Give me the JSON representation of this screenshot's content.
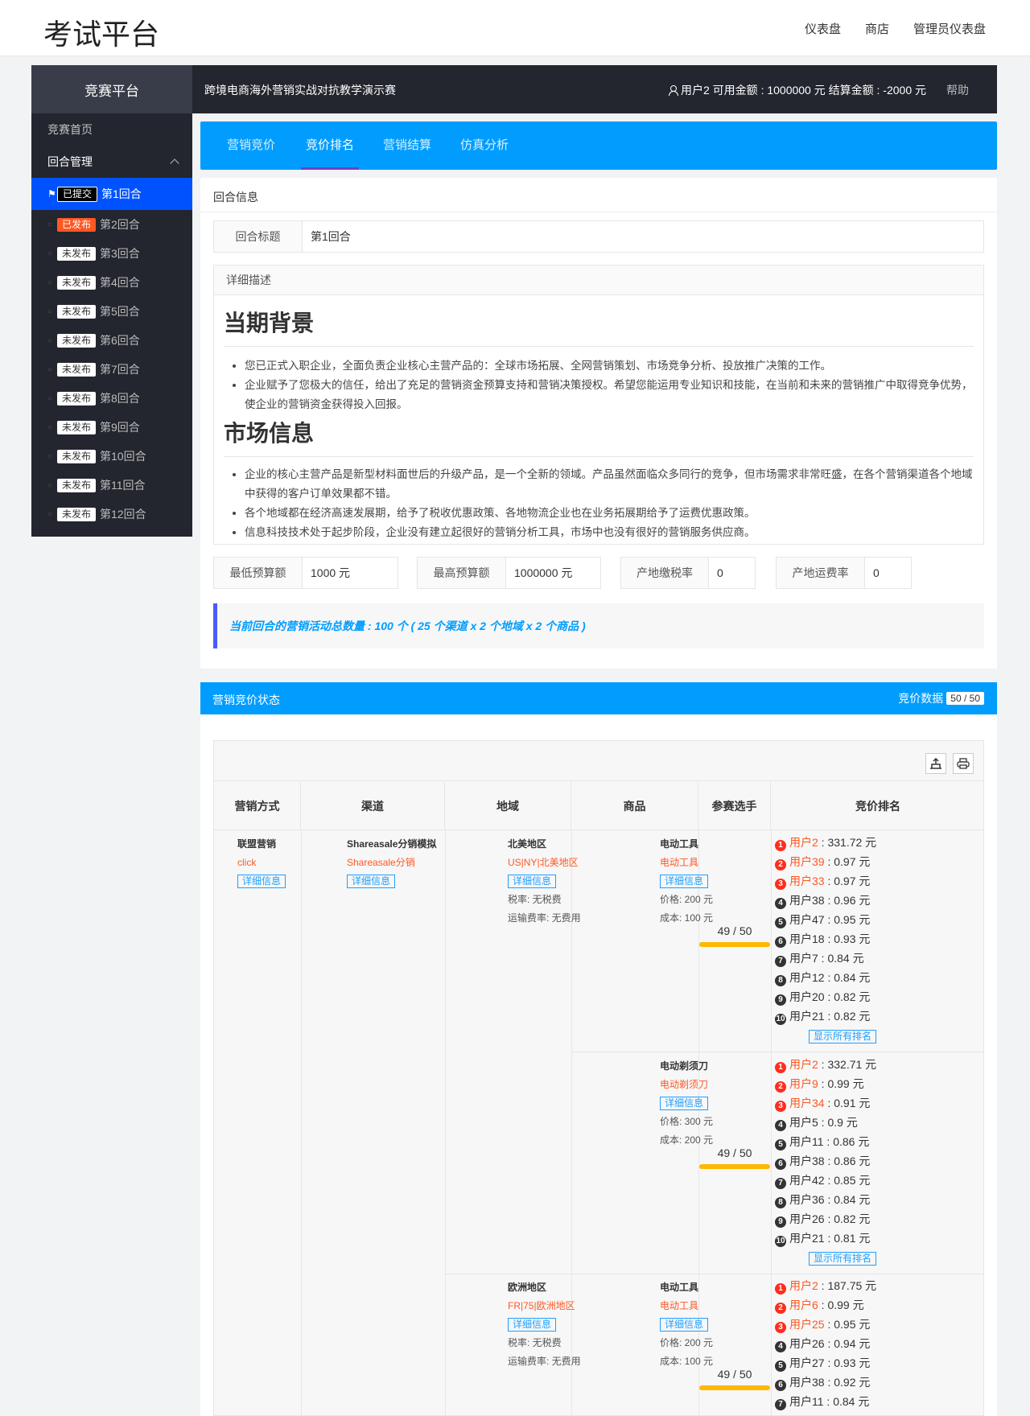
{
  "topbar": {
    "brand": "考试平台",
    "nav": [
      "仪表盘",
      "商店",
      "管理员仪表盘"
    ]
  },
  "sidebar": {
    "title": "竞赛平台",
    "home": "竞赛首页",
    "group": "回合管理",
    "rounds": [
      {
        "badge": "已提交",
        "label": "第1回合"
      },
      {
        "badge": "已发布",
        "label": "第2回合"
      },
      {
        "badge": "未发布",
        "label": "第3回合"
      },
      {
        "badge": "未发布",
        "label": "第4回合"
      },
      {
        "badge": "未发布",
        "label": "第5回合"
      },
      {
        "badge": "未发布",
        "label": "第6回合"
      },
      {
        "badge": "未发布",
        "label": "第7回合"
      },
      {
        "badge": "未发布",
        "label": "第8回合"
      },
      {
        "badge": "未发布",
        "label": "第9回合"
      },
      {
        "badge": "未发布",
        "label": "第10回合"
      },
      {
        "badge": "未发布",
        "label": "第11回合"
      },
      {
        "badge": "未发布",
        "label": "第12回合"
      }
    ]
  },
  "header": {
    "title": "跨境电商海外营销实战对抗教学演示赛",
    "user_info": "用户2 可用金额 : 1000000 元 结算金额 : -2000 元",
    "help": "帮助"
  },
  "tabs": [
    "营销竞价",
    "竞价排名",
    "营销结算",
    "仿真分析"
  ],
  "round_info": {
    "card_title": "回合信息",
    "title_label": "回合标题",
    "title_value": "第1回合",
    "desc_label": "详细描述",
    "heading1": "当期背景",
    "bullets1": [
      "您已正式入职企业，全面负责企业核心主营产品的：全球市场拓展、全网营销策划、市场竞争分析、投放推广决策的工作。",
      "企业赋予了您极大的信任，给出了充足的营销资金预算支持和营销决策授权。希望您能运用专业知识和技能，在当前和未来的营销推广中取得竞争优势，使企业的营销资金获得投入回报。"
    ],
    "heading2": "市场信息",
    "bullets2": [
      "企业的核心主营产品是新型材料面世后的升级产品，是一个全新的领域。产品虽然面临众多同行的竞争，但市场需求非常旺盛，在各个营销渠道各个地域中获得的客户订单效果都不错。",
      "各个地域都在经济高速发展期，给予了税收优惠政策、各地物流企业也在业务拓展期给予了运费优惠政策。",
      "信息科技技术处于起步阶段，企业没有建立起很好的营销分析工具，市场中也没有很好的营销服务供应商。"
    ],
    "min_budget_label": "最低预算额",
    "min_budget": "1000 元",
    "max_budget_label": "最高预算额",
    "max_budget": "1000000 元",
    "tax_label": "产地缴税率",
    "tax": "0",
    "freight_label": "产地运费率",
    "freight": "0",
    "note": "当前回合的营销活动总数量 : 100 个 ( 25 个渠道 x 2 个地域 x 2 个商品 )"
  },
  "status": {
    "title": "营销竞价状态",
    "data_label": "竞价数据",
    "data_count": "50 / 50"
  },
  "table": {
    "headers": [
      "营销方式",
      "渠道",
      "地域",
      "商品",
      "参赛选手",
      "竞价排名"
    ],
    "method": {
      "name": "联盟营销",
      "sub": "click",
      "btn": "详细信息"
    },
    "channel": {
      "name": "Shareasale分销模拟",
      "sub": "Shareasale分销",
      "btn": "详细信息"
    },
    "regions": [
      {
        "name": "北美地区",
        "sub": "US|NY|北美地区",
        "btn": "详细信息",
        "tax": "税率: 无税费",
        "freight": "运输费率: 无费用"
      },
      {
        "name": "欧洲地区",
        "sub": "FR|75|欧洲地区",
        "btn": "详细信息",
        "tax": "税率: 无税费",
        "freight": "运输费率: 无费用"
      }
    ],
    "products": [
      {
        "name": "电动工具",
        "sub": "电动工具",
        "btn": "详细信息",
        "price": "价格: 200 元",
        "cost": "成本: 100 元",
        "players": "49 / 50",
        "ranks": [
          "用户2 : 331.72 元",
          "用户39 : 0.97 元",
          "用户33 : 0.97 元",
          "用户38 : 0.96 元",
          "用户47 : 0.95 元",
          "用户18 : 0.93 元",
          "用户7 : 0.84 元",
          "用户12 : 0.84 元",
          "用户20 : 0.82 元",
          "用户21 : 0.82 元"
        ]
      },
      {
        "name": "电动剃须刀",
        "sub": "电动剃须刀",
        "btn": "详细信息",
        "price": "价格: 300 元",
        "cost": "成本: 200 元",
        "players": "49 / 50",
        "ranks": [
          "用户2 : 332.71 元",
          "用户9 : 0.99 元",
          "用户34 : 0.91 元",
          "用户5 : 0.9 元",
          "用户11 : 0.86 元",
          "用户38 : 0.86 元",
          "用户42 : 0.85 元",
          "用户36 : 0.84 元",
          "用户26 : 0.82 元",
          "用户21 : 0.81 元"
        ]
      },
      {
        "name": "电动工具",
        "sub": "电动工具",
        "btn": "详细信息",
        "price": "价格: 200 元",
        "cost": "成本: 100 元",
        "players": "49 / 50",
        "ranks": [
          "用户2 : 187.75 元",
          "用户6 : 0.99 元",
          "用户25 : 0.95 元",
          "用户26 : 0.94 元",
          "用户27 : 0.93 元",
          "用户38 : 0.92 元",
          "用户11 : 0.84 元"
        ]
      }
    ],
    "show_all": "显示所有排名"
  },
  "colors": {
    "primary": "#009dff",
    "active_nav": "#0052ff",
    "sidebar_bg": "#23262e",
    "danger": "#ff5722",
    "progress": "#ffb800"
  }
}
